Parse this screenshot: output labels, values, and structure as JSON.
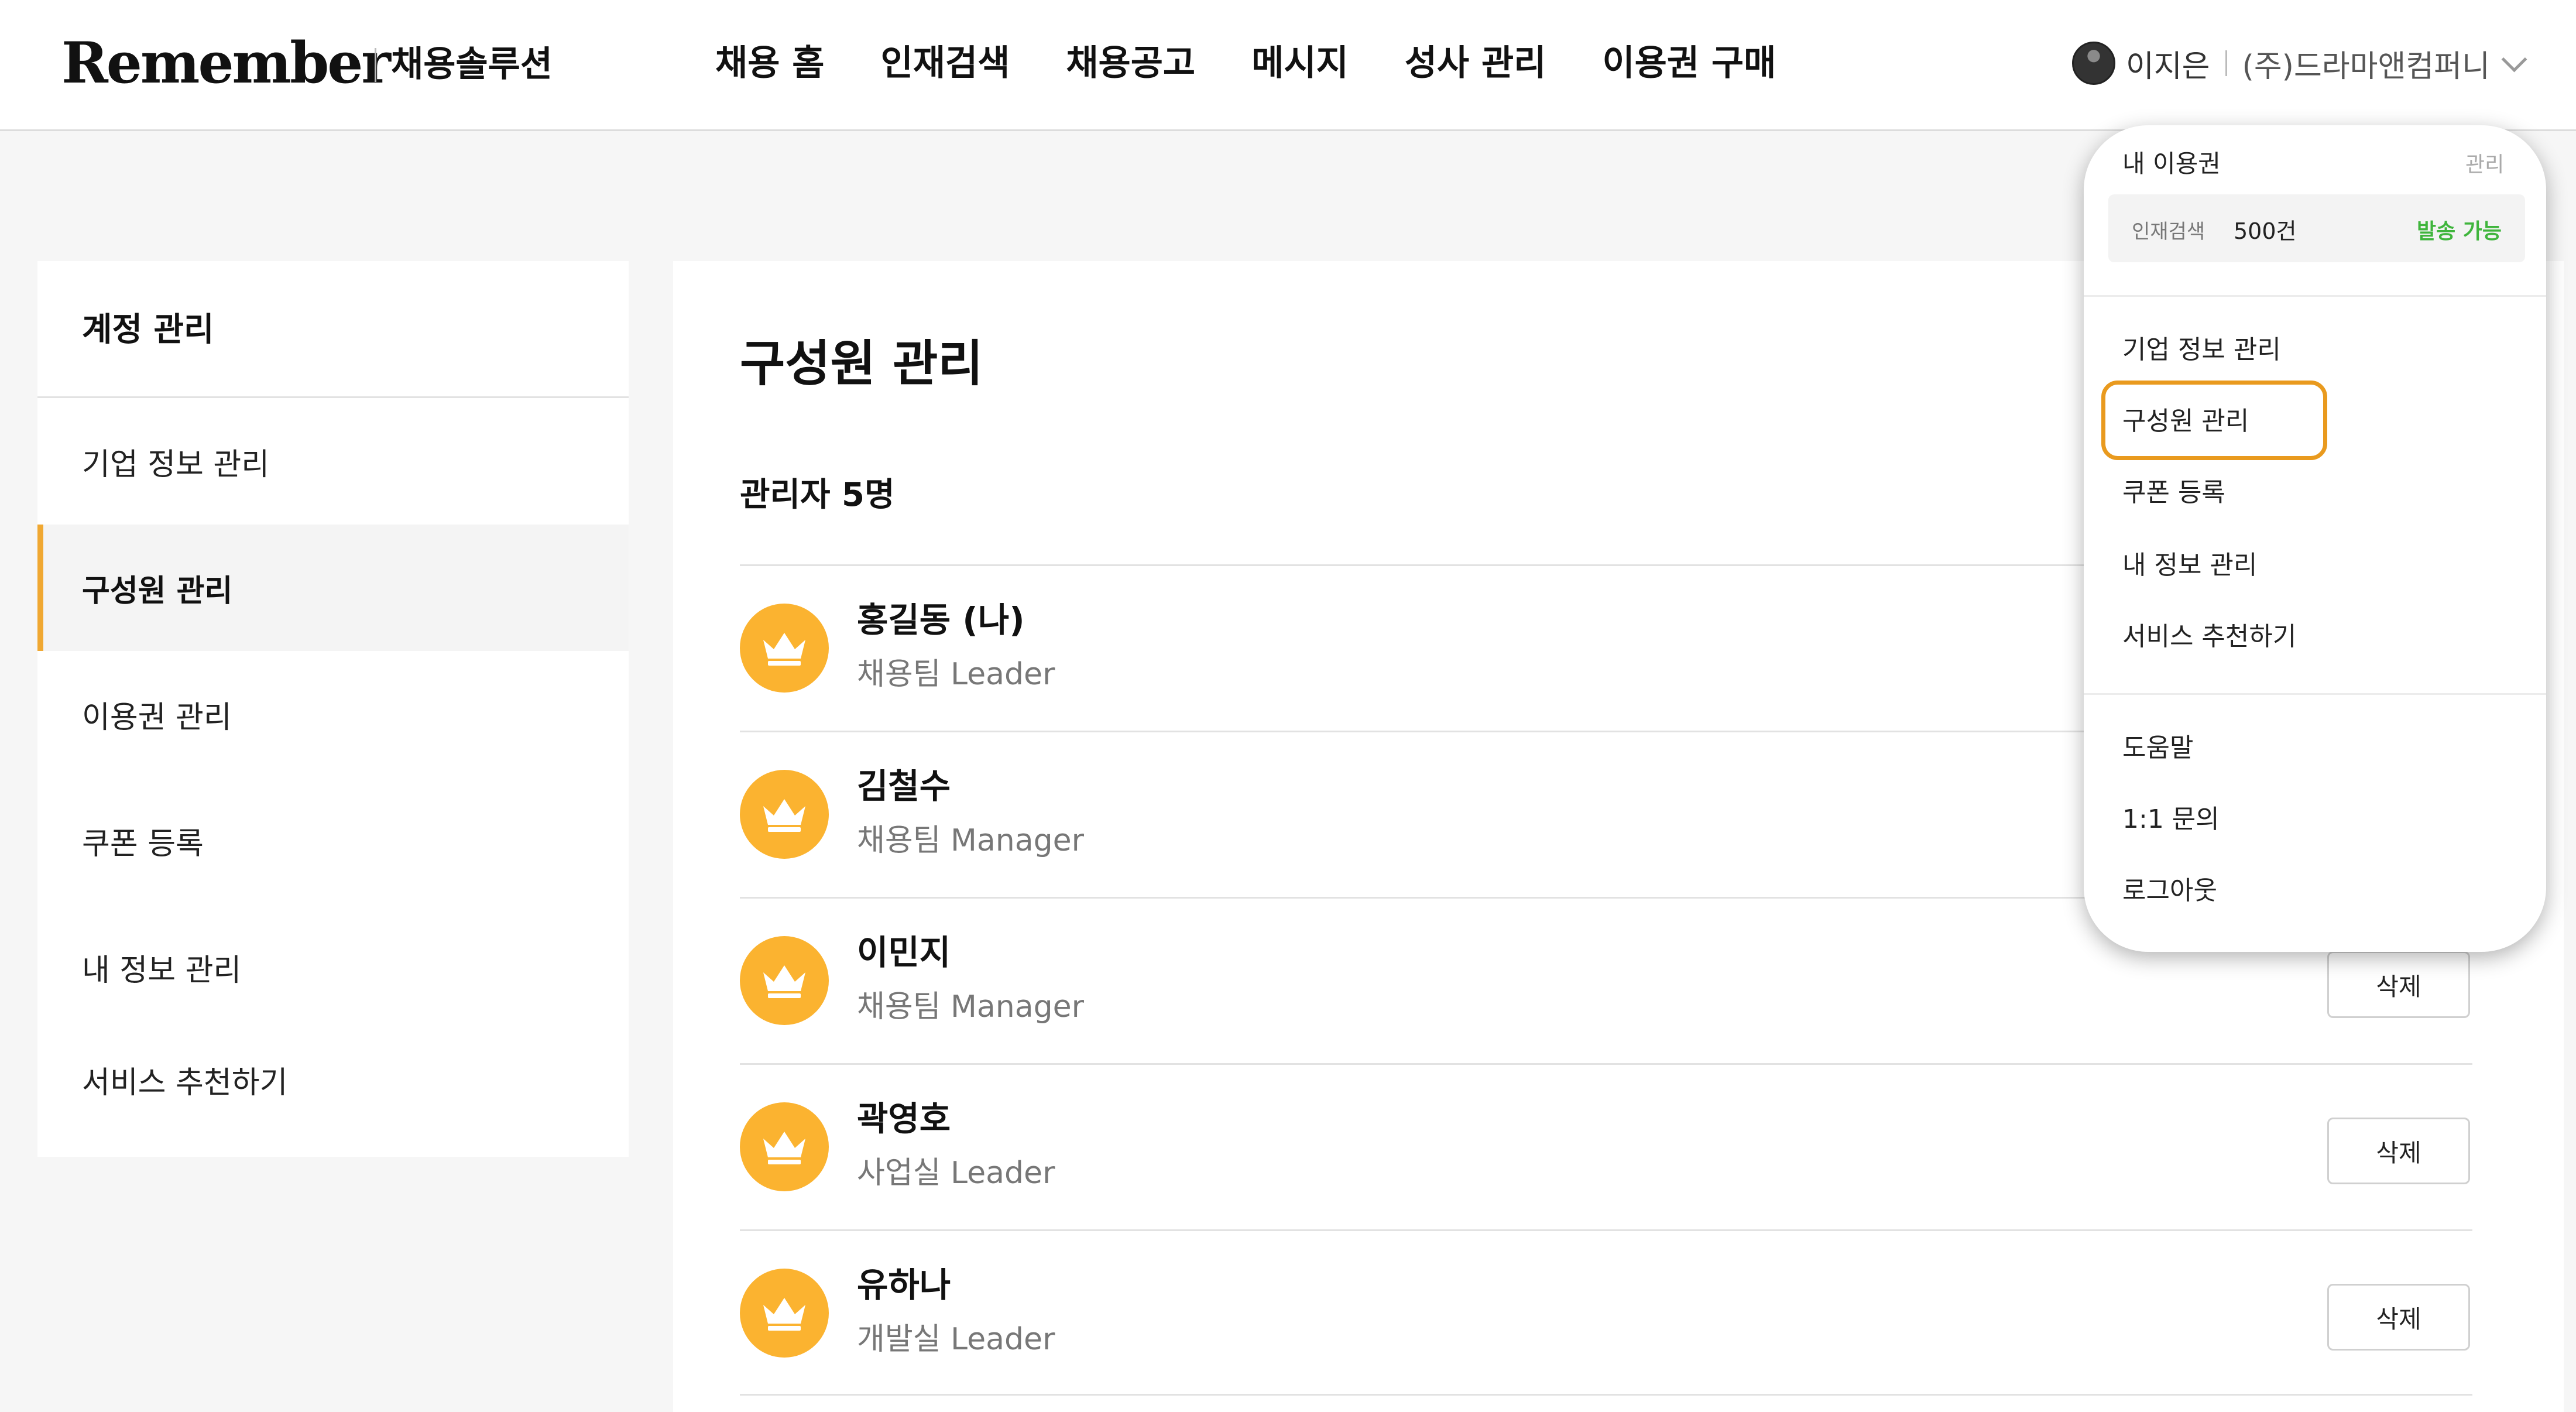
{
  "header": {
    "logo": "Remember",
    "subtitle": "채용솔루션",
    "nav": [
      {
        "label": "채용 홈"
      },
      {
        "label": "인재검색"
      },
      {
        "label": "채용공고"
      },
      {
        "label": "메시지"
      },
      {
        "label": "성사 관리"
      },
      {
        "label": "이용권 구매"
      }
    ],
    "user": {
      "name": "이지은",
      "company": "(주)드라마앤컴퍼니"
    }
  },
  "sidebar": {
    "title": "계정 관리",
    "items": [
      {
        "label": "기업 정보 관리"
      },
      {
        "label": "구성원 관리"
      },
      {
        "label": "이용권 관리"
      },
      {
        "label": "쿠폰 등록"
      },
      {
        "label": "내 정보 관리"
      },
      {
        "label": "서비스 추천하기"
      }
    ],
    "active_index": 1
  },
  "main": {
    "title": "구성원 관리",
    "section": "관리자 5명",
    "members": [
      {
        "name": "홍길동 (나)",
        "role": "채용팀 Leader"
      },
      {
        "name": "김철수",
        "role": "채용팀 Manager"
      },
      {
        "name": "이민지",
        "role": "채용팀 Manager"
      },
      {
        "name": "곽영호",
        "role": "사업실 Leader"
      },
      {
        "name": "유하나",
        "role": "개발실 Leader"
      }
    ],
    "delete_label": "삭제"
  },
  "dropdown": {
    "section_label": "내 이용권",
    "manage_label": "관리",
    "pass": {
      "name": "인재검색",
      "count": "500건",
      "status": "발송 가능"
    },
    "menu": [
      {
        "label": "기업 정보 관리"
      },
      {
        "label": "구성원 관리"
      },
      {
        "label": "쿠폰 등록"
      },
      {
        "label": "내 정보 관리"
      },
      {
        "label": "서비스 추천하기"
      }
    ],
    "help": [
      {
        "label": "도움말"
      },
      {
        "label": "1:1 문의"
      },
      {
        "label": "로그아웃"
      }
    ],
    "highlighted": "구성원 관리"
  },
  "colors": {
    "accent": "#fbb330",
    "highlight": "#e99a1e",
    "status_green": "#3fb53c"
  }
}
